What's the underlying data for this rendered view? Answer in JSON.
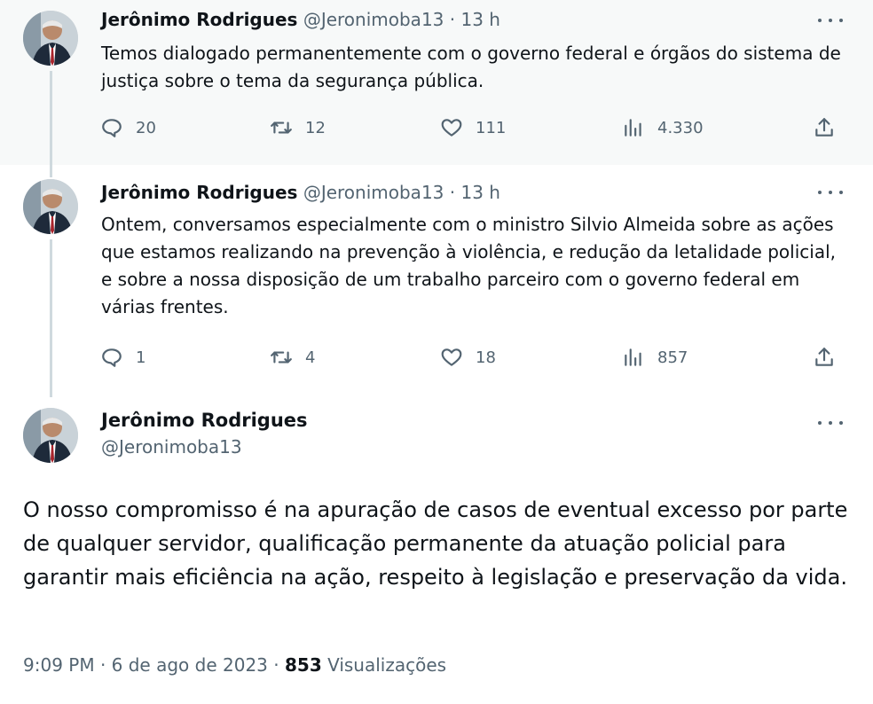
{
  "tweets": [
    {
      "author_name": "Jerônimo Rodrigues",
      "handle": "@Jeronimoba13",
      "time": "· 13 h",
      "text": "Temos dialogado permanentemente com o governo federal e órgãos do sistema de justiça sobre o tema da segurança pública.",
      "replies": "20",
      "retweets": "12",
      "likes": "111",
      "views": "4.330"
    },
    {
      "author_name": "Jerônimo Rodrigues",
      "handle": "@Jeronimoba13",
      "time": "· 13 h",
      "text": "Ontem, conversamos especialmente com o ministro Silvio Almeida sobre as ações que estamos realizando na prevenção à violência, e redução da letalidade policial, e sobre a nossa disposição de um trabalho parceiro com o governo federal em várias frentes.",
      "replies": "1",
      "retweets": "4",
      "likes": "18",
      "views": "857"
    }
  ],
  "main_tweet": {
    "author_name": "Jerônimo Rodrigues",
    "handle": "@Jeronimoba13",
    "text": "O nosso compromisso é na apuração de casos de eventual excesso por parte de qualquer servidor, qualificação permanente da atuação policial para garantir mais eficiência na ação, respeito à legislação e preservação da vida.",
    "timestamp": "9:09 PM · 6 de ago de 2023 · ",
    "views_count": "853",
    "views_label": " Visualizações"
  },
  "icons": {
    "reply": "reply-icon",
    "retweet": "retweet-icon",
    "like": "heart-icon",
    "views": "views-chart-icon",
    "share": "share-icon",
    "more": "more-dots-icon"
  },
  "colors": {
    "text": "#0f1419",
    "secondary": "#536471",
    "thread_line": "#cfd9de",
    "highlight_bg": "#f7f9f9"
  }
}
